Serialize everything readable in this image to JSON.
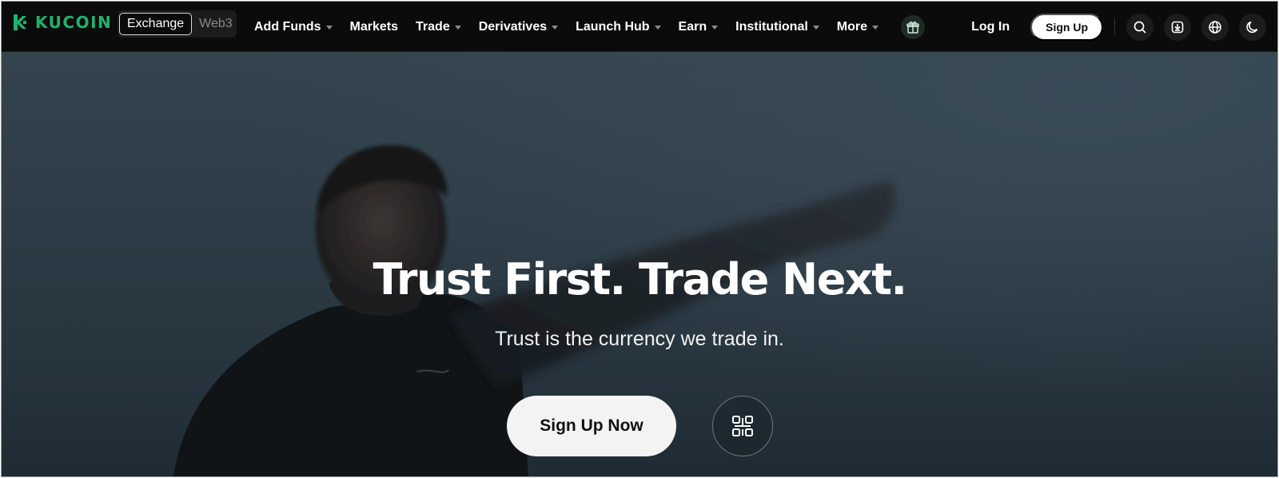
{
  "brand": {
    "name": "KUCOIN",
    "color": "#20b26c"
  },
  "switcher": {
    "active": "Exchange",
    "inactive": "Web3"
  },
  "nav": {
    "items": [
      {
        "label": "Add Funds",
        "dropdown": true
      },
      {
        "label": "Markets",
        "dropdown": false
      },
      {
        "label": "Trade",
        "dropdown": true
      },
      {
        "label": "Derivatives",
        "dropdown": true
      },
      {
        "label": "Launch Hub",
        "dropdown": true
      },
      {
        "label": "Earn",
        "dropdown": true
      },
      {
        "label": "Institutional",
        "dropdown": true
      },
      {
        "label": "More",
        "dropdown": true
      }
    ],
    "gift_icon": "gift-icon"
  },
  "header_right": {
    "login_label": "Log In",
    "signup_label": "Sign Up",
    "icons": [
      "search-icon",
      "download-icon",
      "globe-icon",
      "moon-icon"
    ]
  },
  "hero": {
    "headline": "Trust First. Trade Next.",
    "subline": "Trust is the currency we trade in.",
    "cta_label": "Sign Up Now",
    "qr_icon": "qr-code-icon"
  }
}
